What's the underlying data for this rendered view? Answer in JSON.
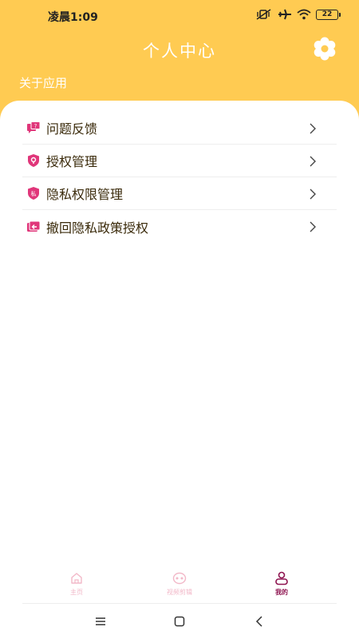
{
  "status_bar": {
    "time": "凌晨1:09",
    "battery": "22",
    "icons": [
      "mute-vibrate-icon",
      "airplane-icon",
      "wifi-icon",
      "battery-icon"
    ]
  },
  "header": {
    "title": "个人中心",
    "settings_icon": "gear-icon",
    "background_color": "#FFCB52"
  },
  "section": {
    "label": "关于应用"
  },
  "menu": {
    "items": [
      {
        "label": "问题反馈",
        "icon": "feedback-icon"
      },
      {
        "label": "授权管理",
        "icon": "auth-shield-icon"
      },
      {
        "label": "隐私权限管理",
        "icon": "privacy-shield-icon",
        "icon_text": "私"
      },
      {
        "label": "撤回隐私政策授权",
        "icon": "revoke-icon"
      }
    ],
    "icon_color": "#E0367A"
  },
  "tabbar": {
    "tabs": [
      {
        "label": "主页",
        "icon": "home-icon",
        "active": false
      },
      {
        "label": "视频剪辑",
        "icon": "video-edit-icon",
        "active": false
      },
      {
        "label": "我的",
        "icon": "profile-icon",
        "active": true
      }
    ],
    "active_color": "#C2185B",
    "inactive_color": "#F2B8C8"
  },
  "navbar": {
    "buttons": [
      "menu-icon",
      "home-square-icon",
      "back-icon"
    ]
  }
}
